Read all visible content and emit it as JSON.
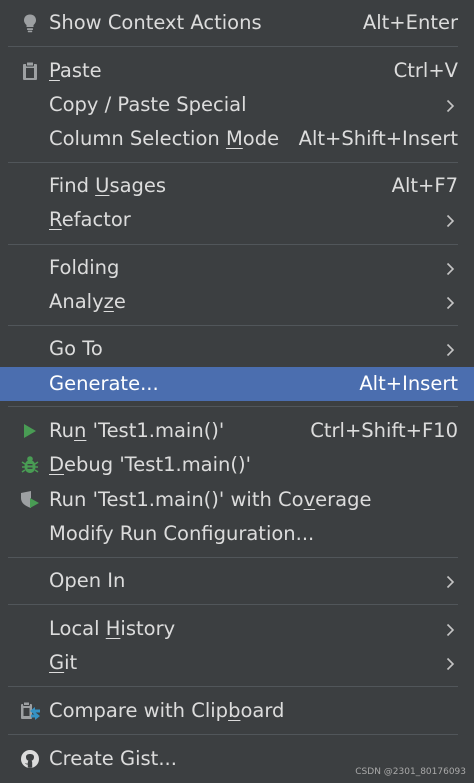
{
  "menu": {
    "items": [
      {
        "key": "show_context_actions",
        "pre": "Show Context Actions",
        "u": "",
        "post": "",
        "shortcut": "Alt+Enter"
      },
      {
        "key": "paste",
        "pre": "",
        "u": "P",
        "post": "aste",
        "shortcut": "Ctrl+V"
      },
      {
        "key": "copy_paste_special",
        "pre": "Copy / Paste Special",
        "u": "",
        "post": "",
        "shortcut": ""
      },
      {
        "key": "column_selection_mode",
        "pre": "Column Selection ",
        "u": "M",
        "post": "ode",
        "shortcut": "Alt+Shift+Insert"
      },
      {
        "key": "find_usages",
        "pre": "Find ",
        "u": "U",
        "post": "sages",
        "shortcut": "Alt+F7"
      },
      {
        "key": "refactor",
        "pre": "",
        "u": "R",
        "post": "efactor",
        "shortcut": ""
      },
      {
        "key": "folding",
        "pre": "Folding",
        "u": "",
        "post": "",
        "shortcut": ""
      },
      {
        "key": "analyze",
        "pre": "Analy",
        "u": "z",
        "post": "e",
        "shortcut": ""
      },
      {
        "key": "go_to",
        "pre": "Go To",
        "u": "",
        "post": "",
        "shortcut": ""
      },
      {
        "key": "generate",
        "pre": "Generate...",
        "u": "",
        "post": "",
        "shortcut": "Alt+Insert"
      },
      {
        "key": "run",
        "pre": "Ru",
        "u": "n",
        "post": " 'Test1.main()'",
        "shortcut": "Ctrl+Shift+F10"
      },
      {
        "key": "debug",
        "pre": "",
        "u": "D",
        "post": "ebug 'Test1.main()'",
        "shortcut": ""
      },
      {
        "key": "run_coverage",
        "pre": "Run 'Test1.main()' with Co",
        "u": "v",
        "post": "erage",
        "shortcut": ""
      },
      {
        "key": "modify_run_config",
        "pre": "Modify Run Configuration...",
        "u": "",
        "post": "",
        "shortcut": ""
      },
      {
        "key": "open_in",
        "pre": "Open In",
        "u": "",
        "post": "",
        "shortcut": ""
      },
      {
        "key": "local_history",
        "pre": "Local ",
        "u": "H",
        "post": "istory",
        "shortcut": ""
      },
      {
        "key": "git",
        "pre": "",
        "u": "G",
        "post": "it",
        "shortcut": ""
      },
      {
        "key": "compare_clipboard",
        "pre": "Compare with Clip",
        "u": "b",
        "post": "oard",
        "shortcut": ""
      },
      {
        "key": "create_gist",
        "pre": "Create Gist...",
        "u": "",
        "post": "",
        "shortcut": ""
      }
    ],
    "selected": "generate"
  },
  "icons": {
    "show_context_actions": "lightbulb-icon",
    "paste": "clipboard-icon",
    "run": "run-triangle-icon",
    "debug": "bug-icon",
    "run_coverage": "coverage-shield-icon",
    "compare_clipboard": "compare-clipboard-icon",
    "create_gist": "github-icon",
    "submenu": "chevron-right-icon"
  },
  "colors": {
    "background": "#3c3f41",
    "text": "#dcdcdc",
    "selection": "#4b6eaf",
    "separator": "#51565a",
    "run_green": "#499c54",
    "coverage_blue": "#3592c4"
  },
  "watermark": "CSDN @2301_80176093"
}
